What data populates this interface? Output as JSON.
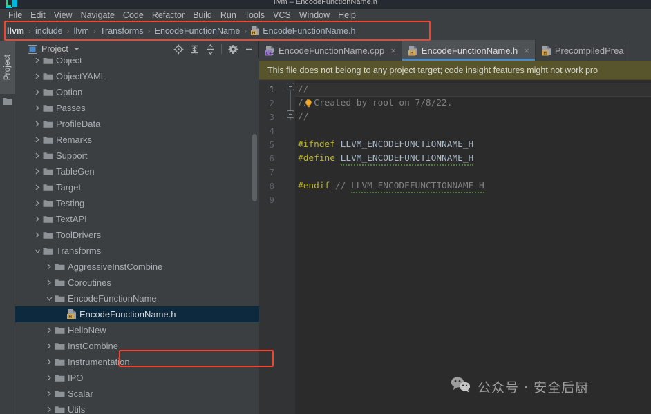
{
  "window": {
    "title": "llvm – EncodeFunctionName.h",
    "app_icon": "clion-logo-icon"
  },
  "menubar": {
    "items": [
      {
        "label": "File"
      },
      {
        "label": "Edit"
      },
      {
        "label": "View"
      },
      {
        "label": "Navigate"
      },
      {
        "label": "Code"
      },
      {
        "label": "Refactor"
      },
      {
        "label": "Build"
      },
      {
        "label": "Run"
      },
      {
        "label": "Tools"
      },
      {
        "label": "VCS"
      },
      {
        "label": "Window"
      },
      {
        "label": "Help"
      }
    ]
  },
  "breadcrumb": {
    "separator": "›",
    "items": [
      {
        "label": "llvm",
        "icon": "none",
        "root": true
      },
      {
        "label": "include",
        "icon": "none",
        "root": false
      },
      {
        "label": "llvm",
        "icon": "none",
        "root": false
      },
      {
        "label": "Transforms",
        "icon": "none",
        "root": false
      },
      {
        "label": "EncodeFunctionName",
        "icon": "none",
        "root": false
      },
      {
        "label": "EncodeFunctionName.h",
        "icon": "h-file-icon",
        "root": false
      }
    ],
    "highlight_color": "#f4442e"
  },
  "toolstrip": {
    "project_label": "Project",
    "folder_icon": "folder-icon"
  },
  "project_panel": {
    "title": "Project",
    "header_icon": "project-view-icon",
    "dropdown_icon": "chevron-down-icon",
    "tools": [
      {
        "name": "locate-in-tree-icon",
        "label": "Select Opened File"
      },
      {
        "name": "expand-all-icon",
        "label": "Expand All"
      },
      {
        "name": "collapse-all-icon",
        "label": "Collapse All"
      },
      {
        "name": "settings-gear-icon",
        "label": "Options"
      },
      {
        "name": "hide-panel-icon",
        "label": "Hide"
      }
    ],
    "tree": [
      {
        "label": "Object",
        "indent": 1,
        "type": "folder",
        "state": "collapsed",
        "selected": false,
        "clipped": true
      },
      {
        "label": "ObjectYAML",
        "indent": 1,
        "type": "folder",
        "state": "collapsed",
        "selected": false
      },
      {
        "label": "Option",
        "indent": 1,
        "type": "folder",
        "state": "collapsed",
        "selected": false
      },
      {
        "label": "Passes",
        "indent": 1,
        "type": "folder",
        "state": "collapsed",
        "selected": false
      },
      {
        "label": "ProfileData",
        "indent": 1,
        "type": "folder",
        "state": "collapsed",
        "selected": false
      },
      {
        "label": "Remarks",
        "indent": 1,
        "type": "folder",
        "state": "collapsed",
        "selected": false
      },
      {
        "label": "Support",
        "indent": 1,
        "type": "folder",
        "state": "collapsed",
        "selected": false
      },
      {
        "label": "TableGen",
        "indent": 1,
        "type": "folder",
        "state": "collapsed",
        "selected": false
      },
      {
        "label": "Target",
        "indent": 1,
        "type": "folder",
        "state": "collapsed",
        "selected": false
      },
      {
        "label": "Testing",
        "indent": 1,
        "type": "folder",
        "state": "collapsed",
        "selected": false
      },
      {
        "label": "TextAPI",
        "indent": 1,
        "type": "folder",
        "state": "collapsed",
        "selected": false
      },
      {
        "label": "ToolDrivers",
        "indent": 1,
        "type": "folder",
        "state": "collapsed",
        "selected": false
      },
      {
        "label": "Transforms",
        "indent": 1,
        "type": "folder",
        "state": "expanded",
        "selected": false
      },
      {
        "label": "AggressiveInstCombine",
        "indent": 2,
        "type": "folder",
        "state": "collapsed",
        "selected": false
      },
      {
        "label": "Coroutines",
        "indent": 2,
        "type": "folder",
        "state": "collapsed",
        "selected": false
      },
      {
        "label": "EncodeFunctionName",
        "indent": 2,
        "type": "folder",
        "state": "expanded",
        "selected": false
      },
      {
        "label": "EncodeFunctionName.h",
        "indent": 3,
        "type": "h-file",
        "state": "leaf",
        "selected": true
      },
      {
        "label": "HelloNew",
        "indent": 2,
        "type": "folder",
        "state": "collapsed",
        "selected": false
      },
      {
        "label": "InstCombine",
        "indent": 2,
        "type": "folder",
        "state": "collapsed",
        "selected": false
      },
      {
        "label": "Instrumentation",
        "indent": 2,
        "type": "folder",
        "state": "collapsed",
        "selected": false
      },
      {
        "label": "IPO",
        "indent": 2,
        "type": "folder",
        "state": "collapsed",
        "selected": false
      },
      {
        "label": "Scalar",
        "indent": 2,
        "type": "folder",
        "state": "collapsed",
        "selected": false
      },
      {
        "label": "Utils",
        "indent": 2,
        "type": "folder",
        "state": "collapsed",
        "selected": false
      }
    ]
  },
  "editor": {
    "tabs": [
      {
        "label": "EncodeFunctionName.cpp",
        "icon": "cpp-file-icon",
        "active": false,
        "closable": true
      },
      {
        "label": "EncodeFunctionName.h",
        "icon": "h-file-icon",
        "active": true,
        "closable": true
      },
      {
        "label": "PrecompiledPrea",
        "icon": "h-file-icon",
        "active": false,
        "closable": false
      }
    ],
    "close_glyph": "×",
    "warning": "This file does not belong to any project target; code insight features might not work pro",
    "warning_bg": "#58552c",
    "line_numbers": [
      "1",
      "2",
      "3",
      "4",
      "5",
      "6",
      "7",
      "8",
      "9"
    ],
    "current_line": 1,
    "lines": [
      {
        "num": "1",
        "parts": [
          {
            "t": "//",
            "c": "comment"
          }
        ]
      },
      {
        "num": "2",
        "parts": [
          {
            "t": "// Created by root on 7/8/22.",
            "c": "comment"
          }
        ]
      },
      {
        "num": "3",
        "parts": [
          {
            "t": "//",
            "c": "comment"
          }
        ]
      },
      {
        "num": "4",
        "parts": []
      },
      {
        "num": "5",
        "parts": [
          {
            "t": "#ifndef",
            "c": "macro"
          },
          {
            "t": " ",
            "c": "plain"
          },
          {
            "t": "LLVM_ENCODEFUNCTIONNAME_H",
            "c": "ident"
          }
        ]
      },
      {
        "num": "6",
        "parts": [
          {
            "t": "#define",
            "c": "macro"
          },
          {
            "t": " ",
            "c": "plain"
          },
          {
            "t": "LLVM_ENCODEFUNCTIONNAME_H",
            "c": "ident-squiggle"
          }
        ]
      },
      {
        "num": "7",
        "parts": []
      },
      {
        "num": "8",
        "parts": [
          {
            "t": "#endif",
            "c": "macro"
          },
          {
            "t": " ",
            "c": "plain"
          },
          {
            "t": "// LLVM_ENCODEFUNCTIONNAME_H",
            "c": "comment-squiggle"
          }
        ]
      },
      {
        "num": "9",
        "parts": []
      }
    ],
    "intention_bulb": "lightbulb-icon"
  },
  "watermark": {
    "icon": "wechat-icon",
    "text": "公众号 · 安全后厨"
  },
  "colors": {
    "accent_blue": "#4a88c7",
    "highlight_red": "#f4442e",
    "selection_blue": "#0d293e",
    "editor_bg": "#2b2b2b",
    "panel_bg": "#3c3f41"
  }
}
